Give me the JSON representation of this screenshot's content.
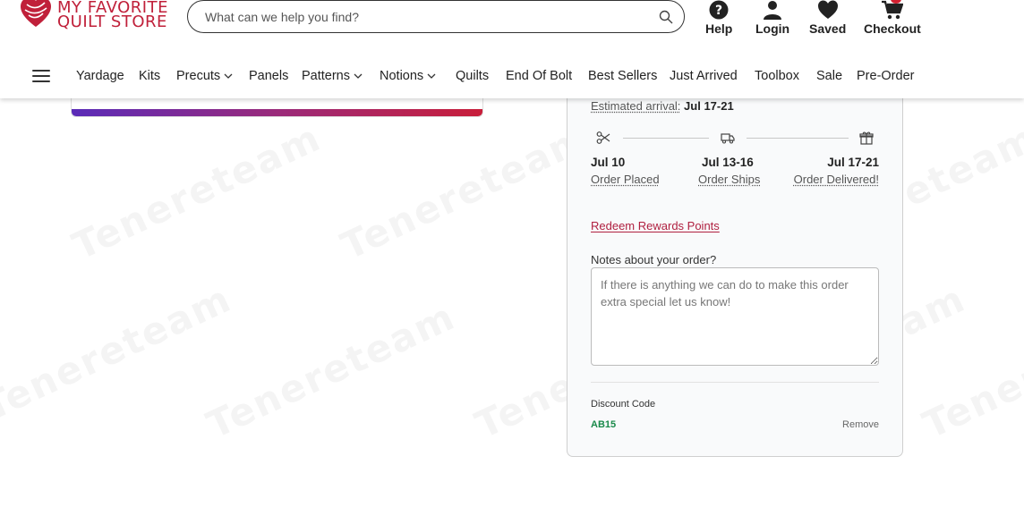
{
  "brand": {
    "line1": "MY FAVORITE",
    "line2": "QUILT STORE",
    "color": "#c0203a"
  },
  "search": {
    "placeholder": "What can we help you find?"
  },
  "header_actions": [
    {
      "label": "Help",
      "icon": "help-circle-icon"
    },
    {
      "label": "Login",
      "icon": "user-icon"
    },
    {
      "label": "Saved",
      "icon": "heart-icon"
    },
    {
      "label": "Checkout",
      "icon": "cart-icon"
    }
  ],
  "nav": [
    {
      "label": "Yardage"
    },
    {
      "label": "Kits"
    },
    {
      "label": "Precuts",
      "dropdown": true
    },
    {
      "label": "Panels"
    },
    {
      "label": "Patterns",
      "dropdown": true
    },
    {
      "label": "Notions",
      "dropdown": true
    },
    {
      "label": "Quilts"
    },
    {
      "label": "End Of Bolt"
    },
    {
      "label": "Best Sellers"
    },
    {
      "label": "Just Arrived"
    },
    {
      "label": "Toolbox"
    },
    {
      "label": "Sale"
    },
    {
      "label": "Pre-Order"
    }
  ],
  "order": {
    "estimated_label": "Estimated arrival:",
    "estimated_value": "Jul 17-21",
    "steps": [
      {
        "date": "Jul 10",
        "label": "Order Placed",
        "icon": "scissors-icon"
      },
      {
        "date": "Jul 13-16",
        "label": "Order Ships",
        "icon": "truck-icon"
      },
      {
        "date": "Jul 17-21",
        "label": "Order Delivered!",
        "icon": "gift-icon"
      }
    ],
    "redeem_label": "Redeem Rewards Points",
    "notes_label": "Notes about your order?",
    "notes_placeholder": "If there is anything we can do to make this order extra special let us know!",
    "discount_label": "Discount Code",
    "discount_code": "AB15",
    "remove_label": "Remove"
  },
  "watermark": "Tenereteam",
  "colors": {
    "accent": "#c0203a",
    "discount": "#1a8a4a",
    "gradient_start": "#5a2bb8",
    "gradient_end": "#c81e3a"
  }
}
